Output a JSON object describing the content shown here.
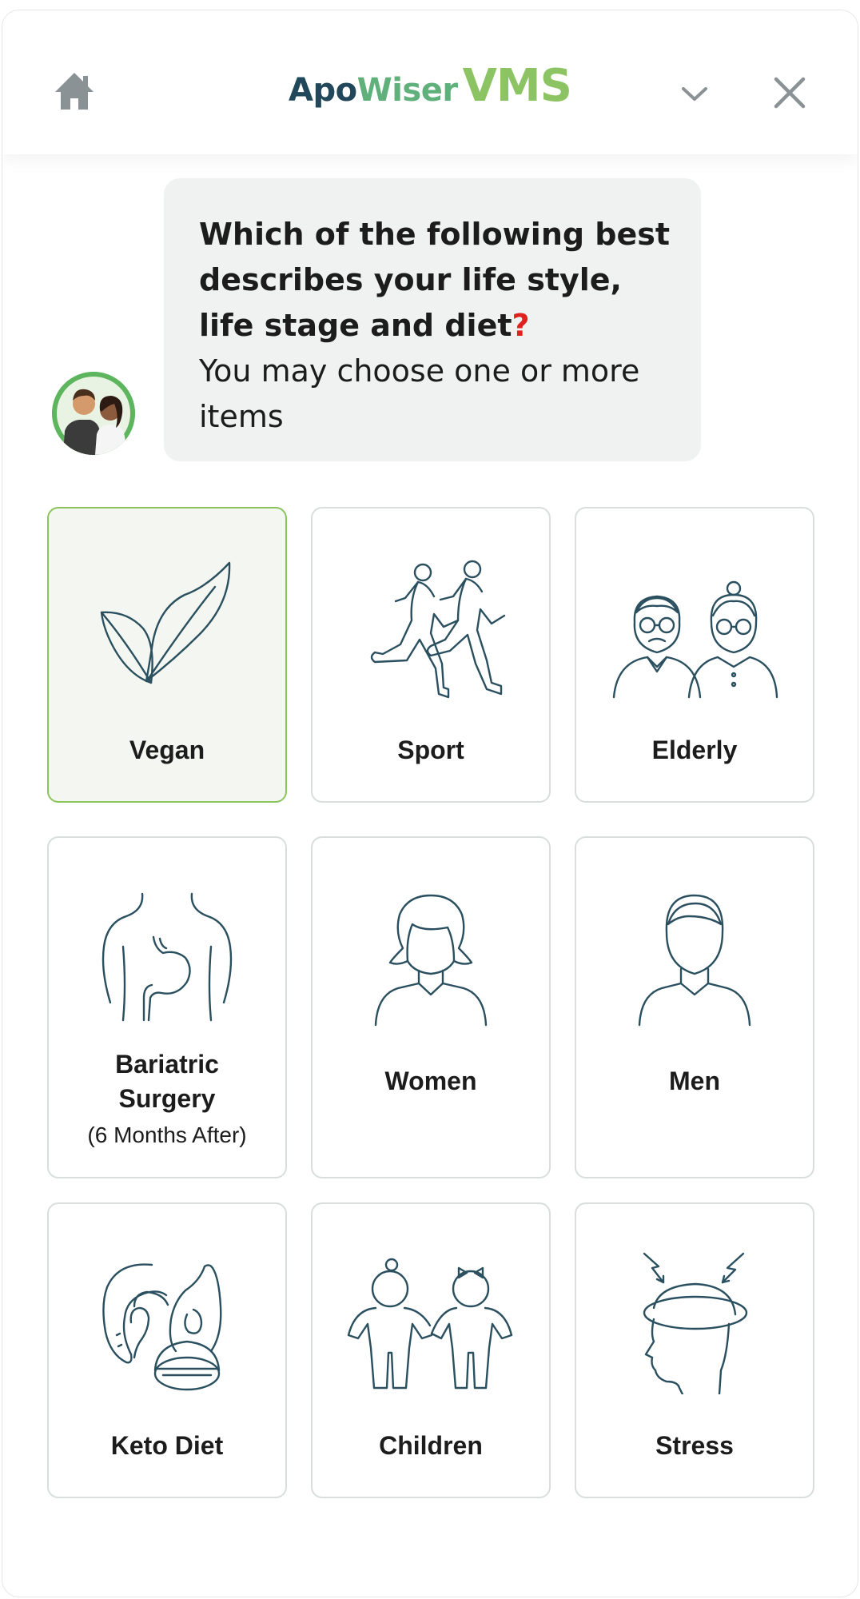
{
  "header": {
    "logo_apo": "Apo",
    "logo_wiser": "Wiser",
    "logo_vms": "VMS",
    "icons": {
      "home": "home-icon",
      "expand": "chevron-down-icon",
      "close": "close-icon"
    }
  },
  "question": {
    "title": "Which of the following best describes your life style, life stage and diet",
    "question_mark": "?",
    "subtitle": "You may choose one or more items"
  },
  "options": [
    {
      "label": "Vegan",
      "icon": "leaf-icon",
      "selected": true
    },
    {
      "label": "Sport",
      "icon": "runners-icon",
      "selected": false
    },
    {
      "label": "Elderly",
      "icon": "elderly-couple-icon",
      "selected": false
    },
    {
      "label": "Bariatric Surgery",
      "sublabel": "(6 Months After)",
      "icon": "stomach-torso-icon",
      "selected": false
    },
    {
      "label": "Women",
      "icon": "woman-icon",
      "selected": false
    },
    {
      "label": "Men",
      "icon": "man-icon",
      "selected": false
    },
    {
      "label": "Keto Diet",
      "icon": "keto-food-icon",
      "selected": false
    },
    {
      "label": "Children",
      "icon": "children-icon",
      "selected": false
    },
    {
      "label": "Stress",
      "icon": "stressed-head-icon",
      "selected": false
    }
  ],
  "colors": {
    "brand_dark": "#21475a",
    "brand_green": "#8dc463",
    "selected_border": "#8bc35c",
    "selected_bg": "#f4f7f1",
    "icon_stroke": "#2a4f5f",
    "question_mark": "#e0211d"
  }
}
